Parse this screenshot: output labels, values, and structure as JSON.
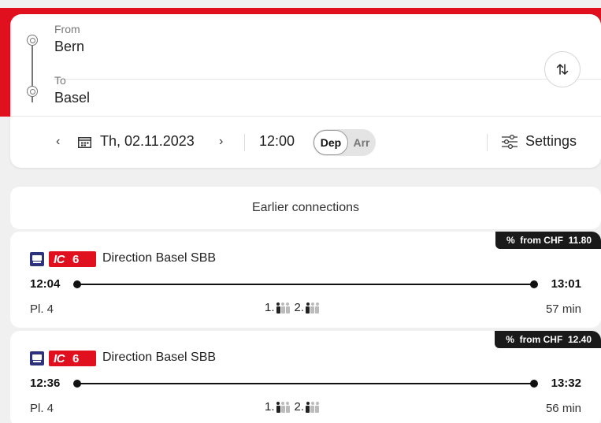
{
  "search": {
    "from_label": "From",
    "from_value": "Bern",
    "to_label": "To",
    "to_value": "Basel",
    "date": "Th, 02.11.2023",
    "time": "12:00",
    "dep_label": "Dep",
    "arr_label": "Arr",
    "mode_selected": "Dep",
    "settings_label": "Settings",
    "prev_symbol": "‹",
    "next_symbol": "›"
  },
  "earlier_label": "Earlier connections",
  "connections": [
    {
      "product_type": "IC",
      "product_line": "6",
      "direction": "Direction Basel SBB",
      "price": "%  from CHF  11.80",
      "departure": "12:04",
      "arrival": "13:01",
      "platform": "Pl. 4",
      "first_class_label": "1.",
      "second_class_label": "2.",
      "first_class_occupancy": 1,
      "second_class_occupancy": 1,
      "duration": "57 min"
    },
    {
      "product_type": "IC",
      "product_line": "6",
      "direction": "Direction Basel SBB",
      "price": "%  from CHF  12.40",
      "departure": "12:36",
      "arrival": "13:32",
      "platform": "Pl. 4",
      "first_class_label": "1.",
      "second_class_label": "2.",
      "first_class_occupancy": 1,
      "second_class_occupancy": 1,
      "duration": "56 min"
    }
  ],
  "icons": {
    "route": "route-dots-icon",
    "swap": "swap-icon",
    "calendar": "calendar-icon",
    "settings": "sliders-icon",
    "train": "train-icon",
    "occupancy": "person-icon"
  },
  "colors": {
    "brand_red": "#e0101e",
    "train_blue": "#2d327d",
    "price_tag_bg": "#1a1a1a"
  }
}
